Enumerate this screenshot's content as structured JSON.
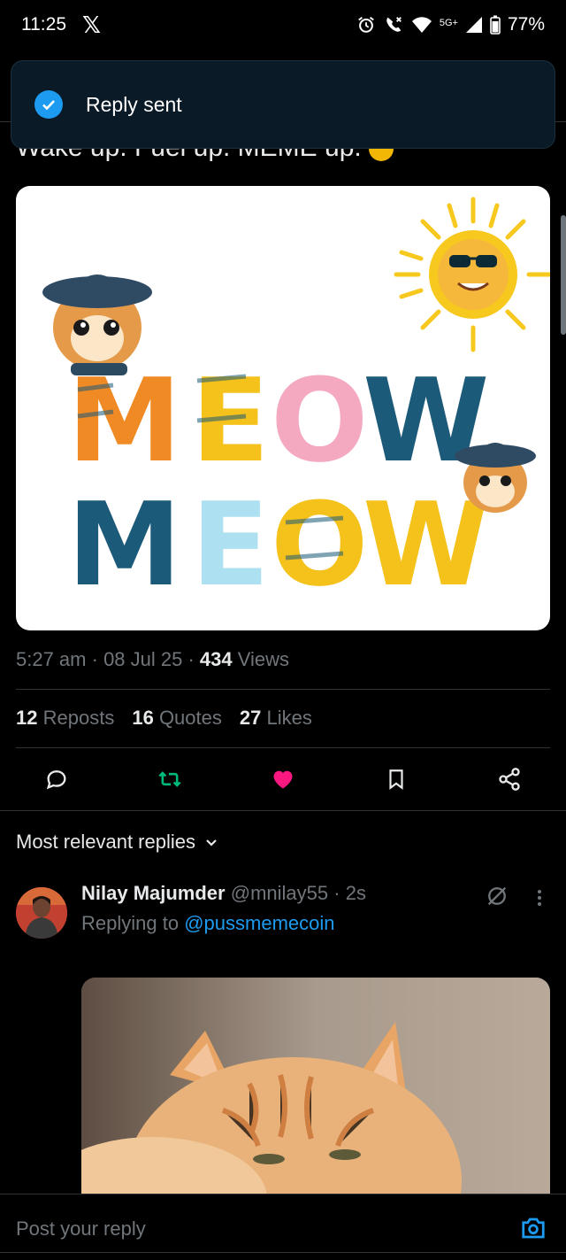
{
  "status_bar": {
    "time": "11:25",
    "network_label": "5G+",
    "battery": "77%"
  },
  "toast": {
    "text": "Reply sent"
  },
  "tweet": {
    "text_partial": "Wake up. Fuel up. MEME up. ",
    "media_alt_words": [
      "MEOW",
      "MEOW"
    ],
    "time": "5:27 am",
    "date": "08 Jul 25",
    "views_count": "434",
    "views_label": "Views",
    "reposts_count": "12",
    "reposts_label": "Reposts",
    "quotes_count": "16",
    "quotes_label": "Quotes",
    "likes_count": "27",
    "likes_label": "Likes"
  },
  "replies": {
    "sort_label": "Most relevant replies",
    "items": [
      {
        "name": "Nilay Majumder",
        "handle": "@mnilay55",
        "time": "2s",
        "replying_prefix": "Replying to",
        "replying_to": "@pussmemecoin"
      }
    ]
  },
  "composer": {
    "placeholder": "Post your reply"
  },
  "colors": {
    "accent": "#1d9bf0",
    "like": "#f91880",
    "repost": "#00ba7c",
    "muted": "#71767b"
  }
}
